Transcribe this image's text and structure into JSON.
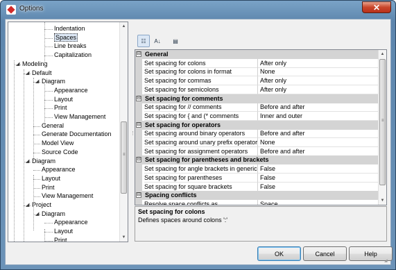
{
  "window": {
    "title": "Options",
    "close_glyph": "✕"
  },
  "tree": {
    "items": [
      {
        "label": "Indentation",
        "level": 3,
        "expander": ""
      },
      {
        "label": "Spaces",
        "level": 3,
        "expander": "",
        "selected": true
      },
      {
        "label": "Line breaks",
        "level": 3,
        "expander": ""
      },
      {
        "label": "Capitalization",
        "level": 3,
        "expander": ""
      },
      {
        "label": "Modeling",
        "level": 0,
        "expander": "◢"
      },
      {
        "label": "Default",
        "level": 1,
        "expander": "◢"
      },
      {
        "label": "Diagram",
        "level": 2,
        "expander": "◢"
      },
      {
        "label": "Appearance",
        "level": 3,
        "expander": ""
      },
      {
        "label": "Layout",
        "level": 3,
        "expander": ""
      },
      {
        "label": "Print",
        "level": 3,
        "expander": ""
      },
      {
        "label": "View Management",
        "level": 3,
        "expander": ""
      },
      {
        "label": "General",
        "level": 2,
        "expander": ""
      },
      {
        "label": "Generate Documentation",
        "level": 2,
        "expander": ""
      },
      {
        "label": "Model View",
        "level": 2,
        "expander": ""
      },
      {
        "label": "Source Code",
        "level": 2,
        "expander": ""
      },
      {
        "label": "Diagram",
        "level": 1,
        "expander": "◢"
      },
      {
        "label": "Appearance",
        "level": 2,
        "expander": ""
      },
      {
        "label": "Layout",
        "level": 2,
        "expander": ""
      },
      {
        "label": "Print",
        "level": 2,
        "expander": ""
      },
      {
        "label": "View Management",
        "level": 2,
        "expander": ""
      },
      {
        "label": "Project",
        "level": 1,
        "expander": "◢"
      },
      {
        "label": "Diagram",
        "level": 2,
        "expander": "◢"
      },
      {
        "label": "Appearance",
        "level": 3,
        "expander": ""
      },
      {
        "label": "Layout",
        "level": 3,
        "expander": ""
      },
      {
        "label": "Print",
        "level": 3,
        "expander": ""
      }
    ]
  },
  "toolbar": {
    "categorized_icon": "categorized-view-icon",
    "alphabetical_icon": "sort-alphabetical-icon",
    "property_pages_icon": "property-pages-icon",
    "alpha_glyph": "A↓"
  },
  "grid": {
    "rows": [
      {
        "type": "category",
        "label": "General",
        "toggle": "⊟"
      },
      {
        "type": "prop",
        "name": "Set spacing for colons",
        "value": "After only"
      },
      {
        "type": "prop",
        "name": "Set spacing for colons in format",
        "value": "None"
      },
      {
        "type": "prop",
        "name": "Set spacing for commas",
        "value": "After only"
      },
      {
        "type": "prop",
        "name": "Set spacing for semicolons",
        "value": "After only"
      },
      {
        "type": "category",
        "label": "Set spacing for comments",
        "toggle": "⊟"
      },
      {
        "type": "prop",
        "name": "Set spacing for // comments",
        "value": "Before and after"
      },
      {
        "type": "prop",
        "name": "Set spacing for { and (* comments",
        "value": "Inner and outer"
      },
      {
        "type": "category",
        "label": "Set spacing for operators",
        "toggle": "⊟"
      },
      {
        "type": "prop",
        "name": "Set spacing around binary operators",
        "value": "Before and after"
      },
      {
        "type": "prop",
        "name": "Set spacing around unary prefix operators",
        "value": "None"
      },
      {
        "type": "prop",
        "name": "Set spacing for assignment operators",
        "value": "Before and after"
      },
      {
        "type": "category",
        "label": "Set spacing for parentheses and brackets",
        "toggle": "⊟"
      },
      {
        "type": "prop",
        "name": "Set spacing for angle brackets in generics",
        "value": "False"
      },
      {
        "type": "prop",
        "name": "Set spacing for parentheses",
        "value": "False"
      },
      {
        "type": "prop",
        "name": "Set spacing for square brackets",
        "value": "False"
      },
      {
        "type": "category",
        "label": "Spacing conflicts",
        "toggle": "⊟"
      },
      {
        "type": "prop",
        "name": "Resolve space conflicts as",
        "value": "Space"
      }
    ]
  },
  "description": {
    "title": "Set spacing for colons",
    "text": "Defines spaces around colons ':'"
  },
  "buttons": {
    "ok": "OK",
    "cancel": "Cancel",
    "help": "Help"
  }
}
